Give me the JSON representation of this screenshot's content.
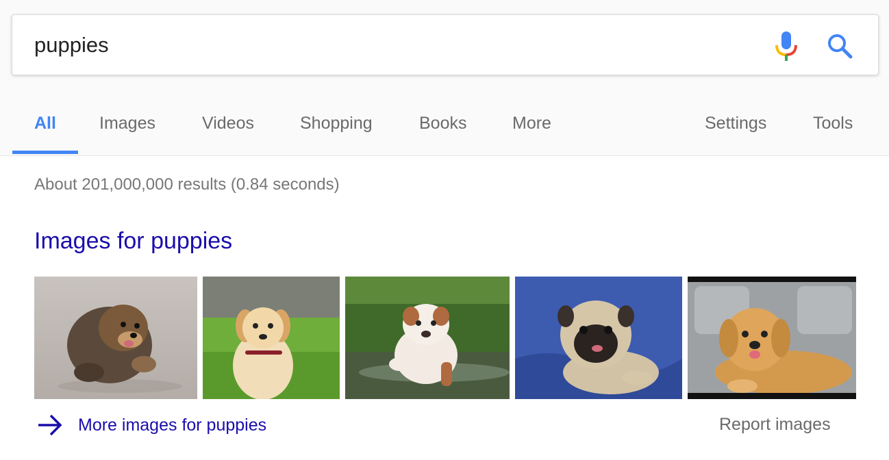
{
  "search": {
    "query": "puppies",
    "mic_icon": "microphone-icon",
    "search_icon": "magnifier-icon"
  },
  "tabs": [
    {
      "label": "All",
      "active": true
    },
    {
      "label": "Images",
      "active": false
    },
    {
      "label": "Videos",
      "active": false
    },
    {
      "label": "Shopping",
      "active": false
    },
    {
      "label": "Books",
      "active": false
    },
    {
      "label": "More",
      "active": false
    },
    {
      "label": "Settings",
      "active": false
    },
    {
      "label": "Tools",
      "active": false
    }
  ],
  "results": {
    "stats": "About 201,000,000 results (0.84 seconds)"
  },
  "images_section": {
    "heading": "Images for puppies",
    "thumbnails": [
      {
        "subject": "fluffy pomeranian puppy on pavement"
      },
      {
        "subject": "golden retriever puppy sitting in grass"
      },
      {
        "subject": "bulldog puppy walking through water"
      },
      {
        "subject": "pug puppy on blue blanket"
      },
      {
        "subject": "golden retriever puppy lying on car seat"
      }
    ],
    "more_label": "More images for puppies",
    "report_label": "Report images"
  },
  "colors": {
    "accent_blue": "#4285f4",
    "link_blue": "#1a0dab",
    "muted_text": "#6a6a6a"
  }
}
